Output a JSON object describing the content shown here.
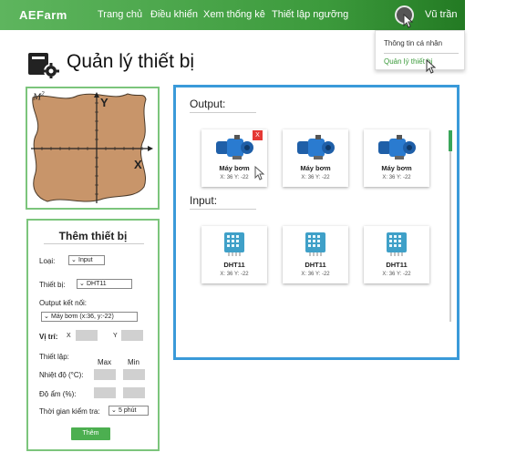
{
  "nav": {
    "brand": "AEFarm",
    "links": [
      "Trang chủ",
      "Điều khiển",
      "Xem thống kê",
      "Thiết lập ngưỡng"
    ],
    "user": "Vũ trần"
  },
  "dropdown": {
    "items": [
      "Thông tin cá nhân",
      "Quản lý thiết bị"
    ]
  },
  "page": {
    "title": "Quản lý thiết bị"
  },
  "map": {
    "label": "M",
    "label_sup": "2",
    "axis_x": "X",
    "axis_y": "Y"
  },
  "form": {
    "title": "Thêm thiết bị",
    "type_label": "Loại:",
    "type_value": "Input",
    "device_label": "Thiết bị:",
    "device_value": "DHT11",
    "output_label": "Output kết nối:",
    "output_value": "Máy bơm (x:36, y:-22)",
    "position_label": "Vị trí:",
    "x_label": "X",
    "y_label": "Y",
    "settings_label": "Thiết lập:",
    "max_label": "Max",
    "min_label": "Min",
    "temp_label": "Nhiệt độ (°C):",
    "humid_label": "Độ ẩm (%):",
    "interval_label": "Thời gian kiểm tra:",
    "interval_value": "5 phút",
    "add_button": "Thêm"
  },
  "devices": {
    "output_title": "Output:",
    "input_title": "Input:",
    "delete_label": "X",
    "outputs": [
      {
        "name": "Máy bơm",
        "coord": "X: 36   Y: -22"
      },
      {
        "name": "Máy bơm",
        "coord": "X: 36   Y: -22"
      },
      {
        "name": "Máy bơm",
        "coord": "X: 36   Y: -22"
      }
    ],
    "inputs": [
      {
        "name": "DHT11",
        "coord": "X: 36   Y: -22"
      },
      {
        "name": "DHT11",
        "coord": "X: 36   Y: -22"
      },
      {
        "name": "DHT11",
        "coord": "X: 36   Y: -22"
      }
    ]
  },
  "colors": {
    "nav_green": "#4caf50",
    "accent_green": "#7cc57c",
    "panel_blue": "#3a9ad9",
    "delete_red": "#e53935"
  },
  "icons": [
    "device-settings-icon",
    "pump-icon",
    "dht11-sensor-icon",
    "chevron-down-icon",
    "cursor-icon"
  ]
}
